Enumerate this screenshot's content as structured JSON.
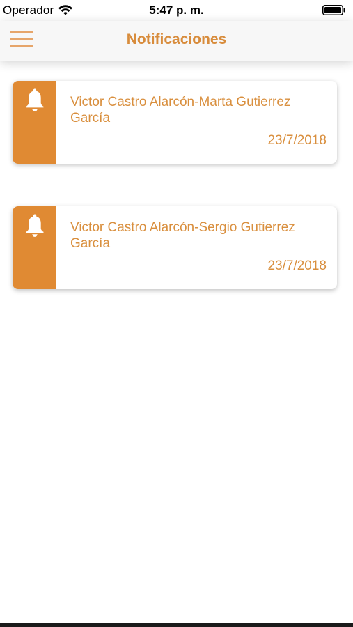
{
  "status_bar": {
    "carrier": "Operador",
    "time": "5:47 p. m.",
    "wifi_icon": "wifi-icon",
    "battery_icon": "battery-icon"
  },
  "nav": {
    "title": "Notificaciones",
    "menu_icon": "hamburger-menu-icon",
    "accent_color": "#d88c3c"
  },
  "notifications": [
    {
      "icon": "bell-icon",
      "title": "Victor Castro Alarcón-Marta Gutierrez García",
      "date": "23/7/2018"
    },
    {
      "icon": "bell-icon",
      "title": "Victor Castro Alarcón-Sergio Gutierrez García",
      "date": "23/7/2018"
    }
  ],
  "colors": {
    "strip": "#e08a33",
    "text": "#d98f3e"
  }
}
